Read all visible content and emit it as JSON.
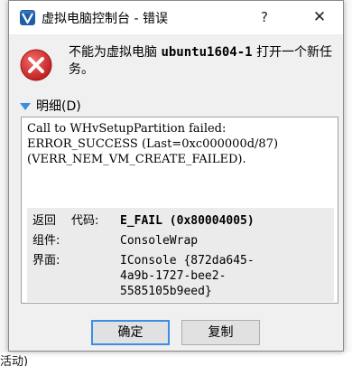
{
  "dialog": {
    "title": "虚拟电脑控制台 - 错误",
    "help_label": "?",
    "close_label": "✕",
    "message_prefix": "不能为虚拟电脑",
    "vm_name": "ubuntu1604-1",
    "message_suffix": "打开一个新任务。",
    "details_label": "明细(D)",
    "error_lines": [
      "Call to WHvSetupPartition failed:",
      "ERROR_SUCCESS (Last=0xc000000d/87)",
      "(VERR_NEM_VM_CREATE_FAILED)."
    ],
    "info": {
      "return_key": "返回",
      "code_key": "代码:",
      "code_val": "E_FAIL (0x80004005)",
      "component_key": "组件:",
      "component_val": "ConsoleWrap",
      "interface_key": "界面:",
      "interface_val": "IConsole {872da645-4a9b-1727-bee2-5585105b9eed}"
    },
    "ok_label": "确定",
    "copy_label": "复制"
  },
  "background": {
    "bottom_text": "活动)"
  },
  "colors": {
    "accent": "#3a8ee6",
    "error_red": "#d92b2b"
  },
  "icons": {
    "title": "virtualbox-icon",
    "error": "error-icon",
    "details": "triangle-down-icon"
  }
}
